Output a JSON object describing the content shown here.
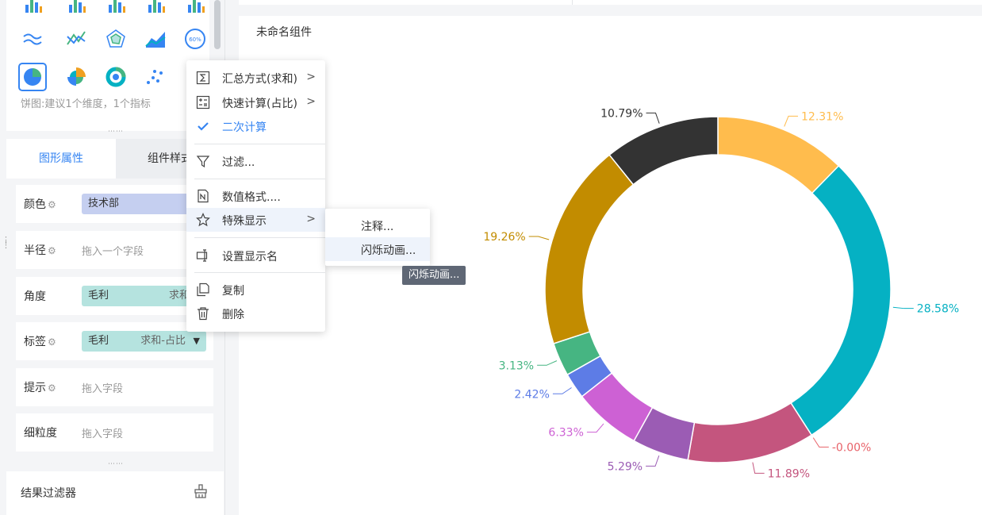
{
  "chart_panel": {
    "hint": "饼图:建议1个维度，1个指标",
    "types": [
      "bar-icon",
      "bar-icon",
      "bar-icon",
      "table-bar-icon",
      "bar-icon",
      "multi-line-icon",
      "line-icon",
      "radar-icon",
      "area-icon",
      "gauge-icon",
      "pie-icon",
      "rose-icon",
      "donut-icon",
      "scatter-icon"
    ],
    "gauge_label": "60%"
  },
  "tabs": {
    "shape": "图形属性",
    "style": "组件样式"
  },
  "fields": {
    "color": {
      "label": "颜色",
      "value": "技术部"
    },
    "radius": {
      "label": "半径",
      "placeholder": "拖入一个字段"
    },
    "angle": {
      "label": "角度",
      "value": "毛利",
      "agg": "求和"
    },
    "tag": {
      "label": "标签",
      "value": "毛利",
      "agg": "求和-占比"
    },
    "tooltip": {
      "label": "提示",
      "placeholder": "拖入字段"
    },
    "granularity": {
      "label": "细粒度",
      "placeholder": "拖入字段"
    }
  },
  "filter": {
    "title": "结果过滤器"
  },
  "widget": {
    "title": "未命名组件"
  },
  "menu": {
    "items": [
      {
        "label": "汇总方式(求和)",
        "icon": "sigma-icon",
        "submenu": true
      },
      {
        "label": "快速计算(占比)",
        "icon": "calculator-icon",
        "submenu": true
      },
      {
        "label": "二次计算",
        "icon": "check-icon",
        "checked": true
      },
      {
        "label": "过滤...",
        "icon": "filter-icon"
      },
      {
        "label": "数值格式....",
        "icon": "number-format-icon"
      },
      {
        "label": "特殊显示",
        "icon": "star-icon",
        "submenu": true,
        "hover": true
      },
      {
        "label": "设置显示名",
        "icon": "rename-icon"
      },
      {
        "label": "复制",
        "icon": "copy-icon"
      },
      {
        "label": "删除",
        "icon": "trash-icon"
      }
    ],
    "arrow": ">"
  },
  "submenu": {
    "items": [
      {
        "label": "注释..."
      },
      {
        "label": "闪烁动画..."
      }
    ]
  },
  "tooltip": {
    "text": "闪烁动画..."
  },
  "chart_data": {
    "type": "pie",
    "slices": [
      {
        "label": "12.31%",
        "value": 12.31,
        "color": "#ffbc4d"
      },
      {
        "label": "28.58%",
        "value": 28.58,
        "color": "#05b1c3"
      },
      {
        "label": "-0.00%",
        "value": 0.0,
        "color": "#e8636a"
      },
      {
        "label": "11.89%",
        "value": 11.89,
        "color": "#c4557e"
      },
      {
        "label": "5.29%",
        "value": 5.29,
        "color": "#9b5cb4"
      },
      {
        "label": "6.33%",
        "value": 6.33,
        "color": "#cd61d4"
      },
      {
        "label": "2.42%",
        "value": 2.42,
        "color": "#5d7ce6"
      },
      {
        "label": "3.13%",
        "value": 3.13,
        "color": "#46b582"
      },
      {
        "label": "19.26%",
        "value": 19.26,
        "color": "#c28c00"
      },
      {
        "label": "10.79%",
        "value": 10.79,
        "color": "#333333"
      }
    ]
  }
}
